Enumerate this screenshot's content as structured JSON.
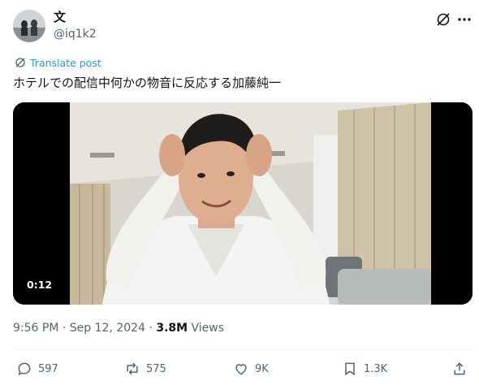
{
  "author": {
    "display_name": "文",
    "handle": "@iq1k2"
  },
  "icons": {
    "grok": "grok-icon",
    "more": "more-icon",
    "translate": "globe-icon",
    "reply": "reply-icon",
    "retweet": "retweet-icon",
    "like": "like-icon",
    "bookmark": "bookmark-icon",
    "share": "share-icon"
  },
  "translate_label": "Translate post",
  "tweet_text": "ホテルでの配信中何かの物音に反応する加藤純一",
  "video": {
    "duration": "0:12"
  },
  "meta": {
    "time": "9:56 PM",
    "separator": " · ",
    "date": "Sep 12, 2024",
    "views_count": "3.8M",
    "views_label": " Views"
  },
  "actions": {
    "replies": "597",
    "retweets": "575",
    "likes": "9K",
    "bookmarks": "1.3K"
  },
  "colors": {
    "text": "#0f1419",
    "secondary": "#536471",
    "link": "#1d9bf0",
    "divider": "#eff3f4"
  }
}
